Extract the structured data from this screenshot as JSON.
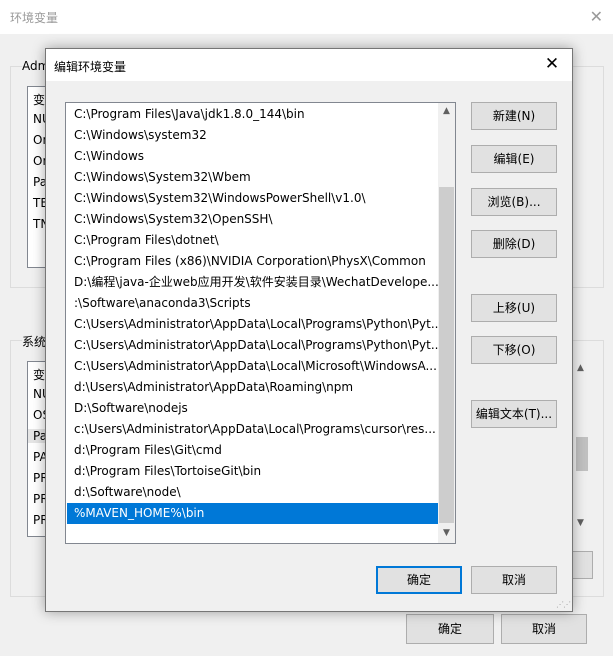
{
  "background_window": {
    "title": "环境变量",
    "user_group_label": "Adm",
    "user_items": [
      "变",
      "NU",
      "On",
      "On",
      "Pa",
      "TE",
      "TN"
    ],
    "system_group_label": "系统",
    "system_items": [
      "变",
      "NU",
      "OS",
      "Pa",
      "PA",
      "PR",
      "PR",
      "PR"
    ],
    "ok_label": "确定",
    "cancel_label": "取消"
  },
  "dialog": {
    "title": "编辑环境变量",
    "paths": [
      "C:\\Program Files\\Java\\jdk1.8.0_144\\bin",
      "C:\\Windows\\system32",
      "C:\\Windows",
      "C:\\Windows\\System32\\Wbem",
      "C:\\Windows\\System32\\WindowsPowerShell\\v1.0\\",
      "C:\\Windows\\System32\\OpenSSH\\",
      "C:\\Program Files\\dotnet\\",
      "C:\\Program Files (x86)\\NVIDIA Corporation\\PhysX\\Common",
      "D:\\编程\\java-企业web应用开发\\软件安装目录\\WechatDevelope...",
      ":\\Software\\anaconda3\\Scripts",
      "C:\\Users\\Administrator\\AppData\\Local\\Programs\\Python\\Pyt...",
      "C:\\Users\\Administrator\\AppData\\Local\\Programs\\Python\\Pyt...",
      "C:\\Users\\Administrator\\AppData\\Local\\Microsoft\\WindowsA...",
      "d:\\Users\\Administrator\\AppData\\Roaming\\npm",
      "D:\\Software\\nodejs",
      "c:\\Users\\Administrator\\AppData\\Local\\Programs\\cursor\\res...",
      "d:\\Program Files\\Git\\cmd",
      "d:\\Program Files\\TortoiseGit\\bin",
      "d:\\Software\\node\\",
      "%MAVEN_HOME%\\bin"
    ],
    "selected_index": 19,
    "buttons": {
      "new": "新建(N)",
      "edit": "编辑(E)",
      "browse": "浏览(B)...",
      "delete": "删除(D)",
      "move_up": "上移(U)",
      "move_down": "下移(O)",
      "edit_text": "编辑文本(T)..."
    },
    "ok_label": "确定",
    "cancel_label": "取消"
  },
  "colors": {
    "selection": "#0078d7",
    "default_button_border": "#0078d7"
  }
}
